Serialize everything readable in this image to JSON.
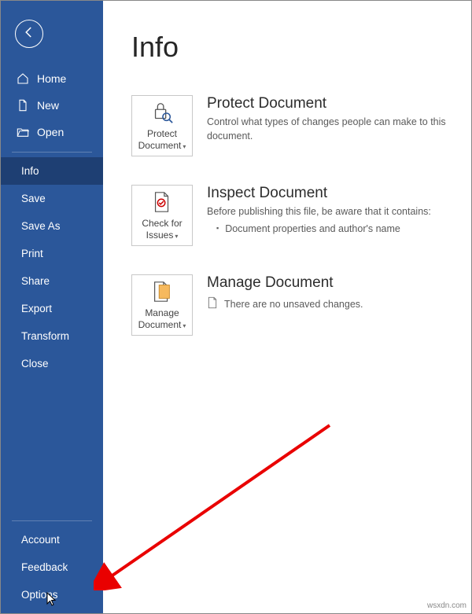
{
  "page_title": "Info",
  "sidebar": {
    "top": [
      {
        "label": "Home"
      },
      {
        "label": "New"
      },
      {
        "label": "Open"
      }
    ],
    "middle": [
      {
        "label": "Info",
        "selected": true
      },
      {
        "label": "Save"
      },
      {
        "label": "Save As"
      },
      {
        "label": "Print"
      },
      {
        "label": "Share"
      },
      {
        "label": "Export"
      },
      {
        "label": "Transform"
      },
      {
        "label": "Close"
      }
    ],
    "bottom": [
      {
        "label": "Account"
      },
      {
        "label": "Feedback"
      },
      {
        "label": "Options"
      }
    ]
  },
  "sections": {
    "protect": {
      "button_label": "Protect Document",
      "title": "Protect Document",
      "desc": "Control what types of changes people can make to this document."
    },
    "inspect": {
      "button_label": "Check for Issues",
      "title": "Inspect Document",
      "desc": "Before publishing this file, be aware that it contains:",
      "item1": "Document properties and author's name"
    },
    "manage": {
      "button_label": "Manage Document",
      "title": "Manage Document",
      "desc": "There are no unsaved changes."
    }
  },
  "watermark": "wsxdn.com"
}
